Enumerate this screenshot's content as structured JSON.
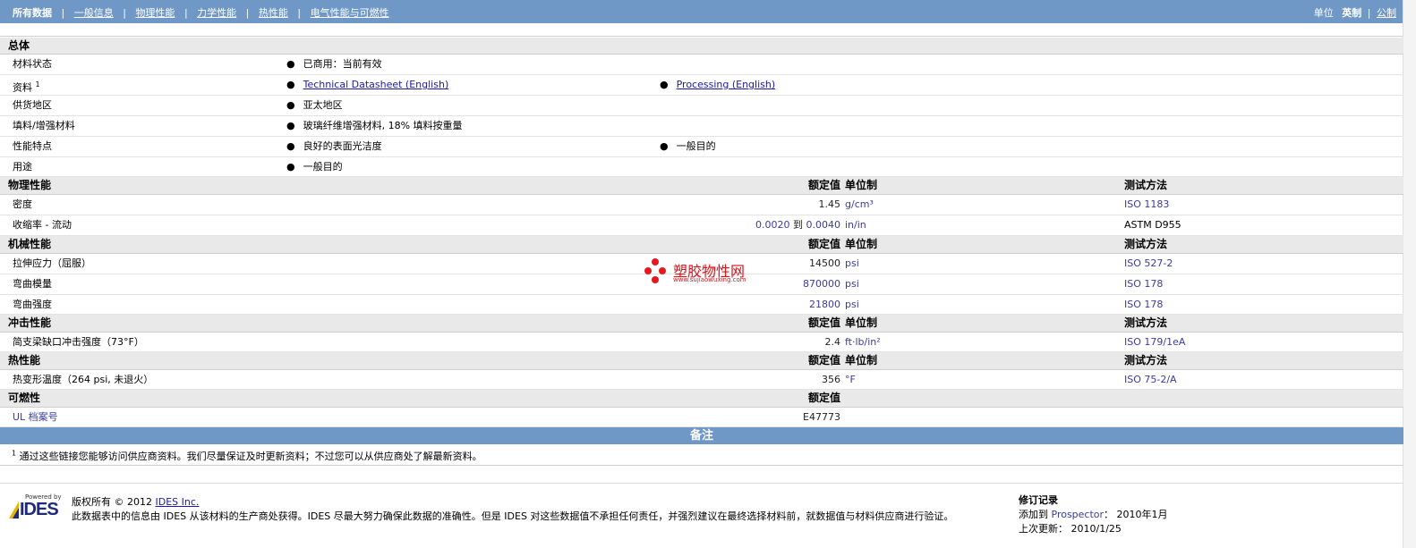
{
  "nav": {
    "items": [
      {
        "label": "所有数据"
      },
      {
        "label": "一般信息"
      },
      {
        "label": "物理性能"
      },
      {
        "label": "力学性能"
      },
      {
        "label": "热性能"
      },
      {
        "label": "电气性能与可燃性"
      }
    ],
    "separator": "|"
  },
  "units": {
    "label": "单位",
    "english": "英制",
    "separator": "|",
    "metric": "公制"
  },
  "general": {
    "section_title": "总体",
    "rows": [
      {
        "label": "材料状态",
        "col1": "已商用：当前有效",
        "col2": ""
      },
      {
        "label": "资料",
        "sup": "1",
        "col1": "Technical Datasheet (English)",
        "col2": "Processing (English)"
      },
      {
        "label": "供货地区",
        "col1": "亚太地区",
        "col2": ""
      },
      {
        "label": "填料/增强材料",
        "col1": "玻璃纤维增强材料, 18% 填料按重量",
        "col2": ""
      },
      {
        "label": "性能特点",
        "col1": "良好的表面光洁度",
        "col2": "一般目的"
      },
      {
        "label": "用途",
        "col1": "一般目的",
        "col2": ""
      }
    ]
  },
  "table_headers": {
    "value": "额定值",
    "unit": "单位制",
    "method": "测试方法"
  },
  "physical": {
    "title": "物理性能",
    "rows": [
      {
        "label": "密度",
        "value": "1.45",
        "unit": "g/cm³",
        "method": "ISO 1183"
      },
      {
        "label": "收缩率 - 流动",
        "value_prefix": "0.0020",
        "value_join": "到",
        "value": "0.0040",
        "unit": "in/in",
        "method": "ASTM D955"
      }
    ]
  },
  "mechanical": {
    "title": "机械性能",
    "rows": [
      {
        "label": "拉伸应力（屈服）",
        "value": "14500",
        "unit": "psi",
        "method": "ISO 527-2"
      },
      {
        "label": "弯曲模量",
        "value": "870000",
        "unit": "psi",
        "method": "ISO 178"
      },
      {
        "label": "弯曲强度",
        "value": "21800",
        "unit": "psi",
        "method": "ISO 178"
      }
    ]
  },
  "impact": {
    "title": "冲击性能",
    "rows": [
      {
        "label": "简支梁缺口冲击强度（73°F）",
        "value": "2.4",
        "unit": "ft·lb/in²",
        "method": "ISO 179/1eA"
      }
    ]
  },
  "thermal": {
    "title": "热性能",
    "rows": [
      {
        "label": "热变形温度（264 psi, 未退火）",
        "value": "356",
        "unit": "°F",
        "method": "ISO 75-2/A"
      }
    ]
  },
  "flammability": {
    "title": "可燃性",
    "rows": [
      {
        "label": "UL 档案号",
        "value": "E47773"
      }
    ]
  },
  "notes": {
    "title": "备注",
    "sup": "1",
    "text": "通过这些链接您能够访问供应商资料。我们尽量保证及时更新资料；不过您可以从供应商处了解最新资料。"
  },
  "footer": {
    "logo_powered": "Powered by",
    "logo_text": "IDES",
    "copyright_prefix": "版权所有 © 2012",
    "copyright_link": "IDES Inc.",
    "disclaimer": "此数据表中的信息由 IDES 从该材料的生产商处获得。IDES 尽最大努力确保此数据的准确性。但是 IDES 对这些数据值不承担任何责任，并强烈建议在最终选择材料前，就数据值与材料供应商进行验证。",
    "revision_title": "修订记录",
    "added_label": "添加到",
    "added_link": "Prospector",
    "added_sep": "：",
    "added_value": "2010年1月",
    "updated_label": "上次更新：",
    "updated_value": "2010/1/25"
  },
  "watermark": {
    "text": "塑胶物性网",
    "sub": "www.sujiaowuxing.com"
  },
  "colors": {
    "bar": "#6f98c6",
    "header_row": "#e9e9e9",
    "link": "#1a1aa6",
    "watermark": "#e8161e"
  }
}
